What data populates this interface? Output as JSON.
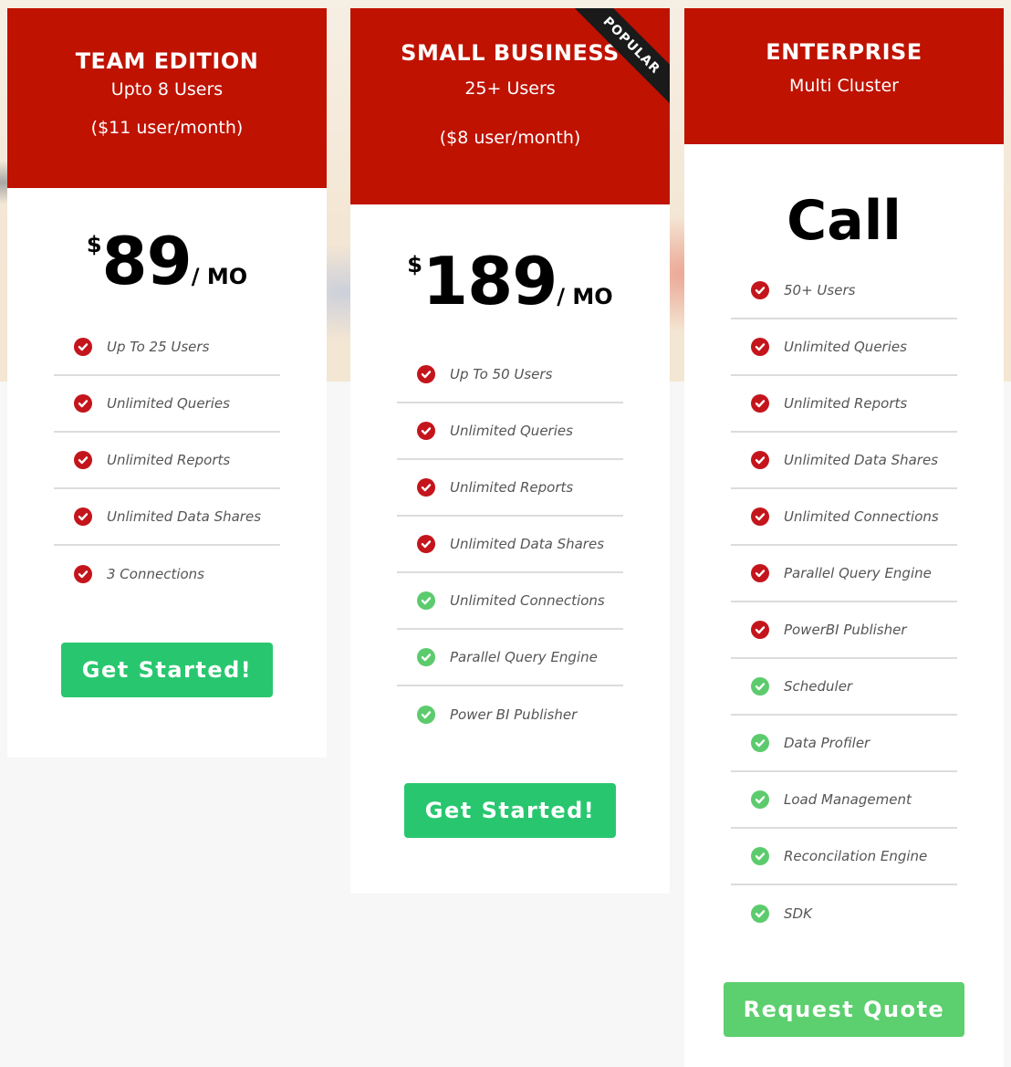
{
  "colors": {
    "header_red": "#bf1200",
    "check_red": "#c4151c",
    "check_green": "#5ccb6d",
    "cta_green": "#28c76f",
    "cta_light_green": "#5ccf6e",
    "ribbon": "#1a1a1a"
  },
  "plans": [
    {
      "name": "TEAM EDITION",
      "subtitle": "Upto 8 Users",
      "subtitle2": "($11 user/month)",
      "price": {
        "currency": "$",
        "amount": "89",
        "period": "/ MO"
      },
      "features": [
        {
          "label": "Up To 25 Users",
          "icon": "check-circle-icon",
          "color": "red"
        },
        {
          "label": "Unlimited Queries",
          "icon": "check-circle-icon",
          "color": "red"
        },
        {
          "label": "Unlimited Reports",
          "icon": "check-circle-icon",
          "color": "red"
        },
        {
          "label": "Unlimited Data Shares",
          "icon": "check-circle-icon",
          "color": "red"
        },
        {
          "label": "3 Connections",
          "icon": "check-circle-icon",
          "color": "red"
        }
      ],
      "cta": "Get Started!"
    },
    {
      "name": "SMALL BUSINESS",
      "subtitle": "25+ Users",
      "subtitle2": "($8 user/month)",
      "badge": "POPULAR",
      "price": {
        "currency": "$",
        "amount": "189",
        "period": "/ MO"
      },
      "features": [
        {
          "label": "Up To 50 Users",
          "icon": "check-circle-icon",
          "color": "red"
        },
        {
          "label": "Unlimited Queries",
          "icon": "check-circle-icon",
          "color": "red"
        },
        {
          "label": "Unlimited Reports",
          "icon": "check-circle-icon",
          "color": "red"
        },
        {
          "label": "Unlimited Data Shares",
          "icon": "check-circle-icon",
          "color": "red"
        },
        {
          "label": "Unlimited Connections",
          "icon": "check-circle-icon",
          "color": "green"
        },
        {
          "label": "Parallel Query Engine",
          "icon": "check-circle-icon",
          "color": "green"
        },
        {
          "label": "Power BI Publisher",
          "icon": "check-circle-icon",
          "color": "green"
        }
      ],
      "cta": "Get Started!"
    },
    {
      "name": "ENTERPRISE",
      "subtitle": "Multi Cluster",
      "price_text": "Call",
      "features": [
        {
          "label": "50+ Users",
          "icon": "check-circle-icon",
          "color": "red"
        },
        {
          "label": "Unlimited Queries",
          "icon": "check-circle-icon",
          "color": "red"
        },
        {
          "label": "Unlimited Reports",
          "icon": "check-circle-icon",
          "color": "red"
        },
        {
          "label": "Unlimited Data Shares",
          "icon": "check-circle-icon",
          "color": "red"
        },
        {
          "label": "Unlimited Connections",
          "icon": "check-circle-icon",
          "color": "red"
        },
        {
          "label": "Parallel Query Engine",
          "icon": "check-circle-icon",
          "color": "red"
        },
        {
          "label": "PowerBI Publisher",
          "icon": "check-circle-icon",
          "color": "red"
        },
        {
          "label": "Scheduler",
          "icon": "check-circle-icon",
          "color": "green"
        },
        {
          "label": "Data Profiler",
          "icon": "check-circle-icon",
          "color": "green"
        },
        {
          "label": "Load Management",
          "icon": "check-circle-icon",
          "color": "green"
        },
        {
          "label": "Reconcilation Engine",
          "icon": "check-circle-icon",
          "color": "green"
        },
        {
          "label": "SDK",
          "icon": "check-circle-icon",
          "color": "green"
        }
      ],
      "cta": "Request Quote"
    }
  ]
}
